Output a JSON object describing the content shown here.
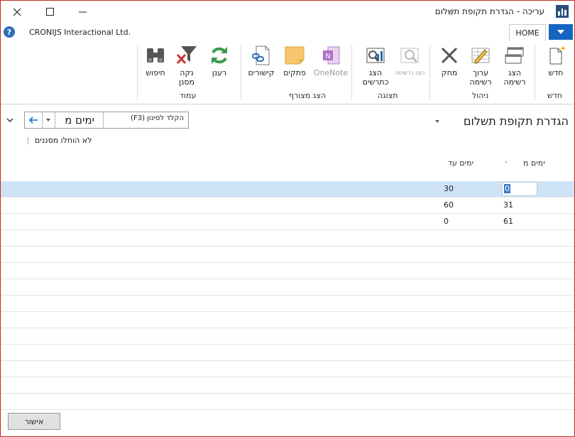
{
  "window": {
    "title": "עריכה - הגדרת תקופת תשלום"
  },
  "tabs": {
    "home_label": "HOME",
    "company": "CRONIJS Interactional Ltd."
  },
  "ribbon": {
    "groups": {
      "new": "חדש",
      "manage": "ניהול",
      "view": "תצוגה",
      "show_attached": "הצג מצורף",
      "page": "עמוד"
    },
    "buttons": {
      "new": "חדש",
      "view_list": "הצג רשימה",
      "edit_list": "ערוך רשימה",
      "delete": "מחק",
      "show_as_list": "הצג כרשימה",
      "show_as_chart": "הצג כתרשים",
      "onenote": "OneNote",
      "notes": "פתקים",
      "links": "קישורים",
      "refresh": "רענן",
      "clear_filter": "נקה מסנן",
      "find": "חיפוש"
    }
  },
  "page": {
    "title": "הגדרת תקופת תשלום",
    "filter_field": "ימים מ",
    "filter_placeholder": "הקלד לסינון (F3)",
    "no_filters": "לא הוחלו מסננים"
  },
  "table": {
    "columns": {
      "days_from": "ימים מ",
      "days_to": "ימים עד"
    },
    "rows": [
      {
        "days_from": "0",
        "days_to": "30"
      },
      {
        "days_from": "31",
        "days_to": "60"
      },
      {
        "days_from": "61",
        "days_to": "0"
      }
    ]
  },
  "footer": {
    "ok_label": "אישור"
  },
  "colors": {
    "accent": "#1565c0",
    "selection": "#cfe3f7"
  }
}
